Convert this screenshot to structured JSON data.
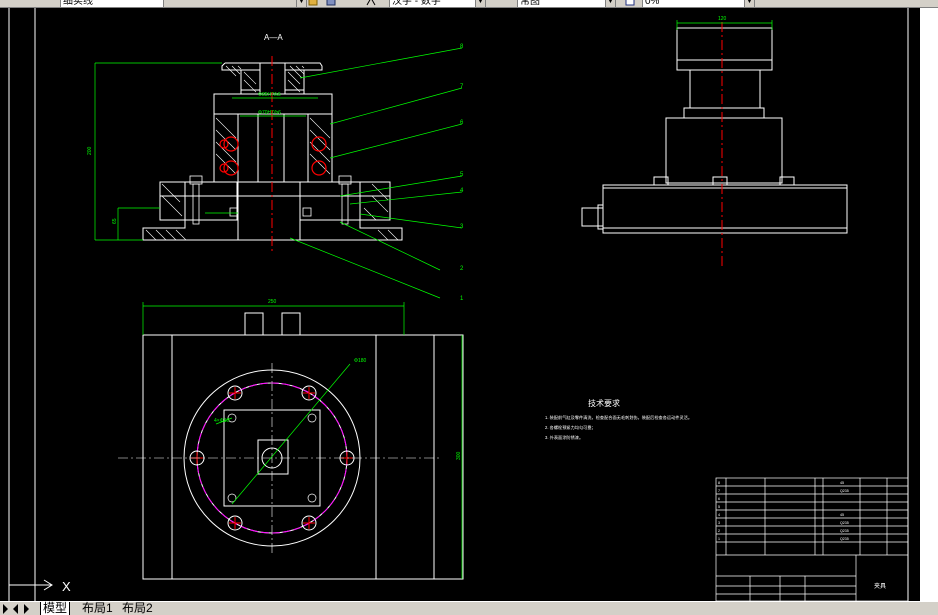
{
  "toolbar": {
    "layer_name": "细实线",
    "text_style": "汉字 - 数字",
    "dim_style": "常图",
    "layer_state": "0%"
  },
  "drawing": {
    "section_label": "A—A",
    "tech_title": "技术要求",
    "tech_notes": [
      "1. 装配前气缸及零件清洗，检查配合面无毛刺划伤。装配后检查各运动件灵活。",
      "2. 各螺栓预紧力均匀可靠；",
      "3. 外表面涂防锈漆。"
    ],
    "title_block_name": "夹具",
    "balloons": [
      "8",
      "7",
      "6",
      "5",
      "4",
      "3",
      "2",
      "1"
    ],
    "dims": {
      "height_total": "200",
      "height_lower": "65",
      "fit_top": "Φ85H7/k6",
      "fit_mid": "Φ70H7/h6",
      "base_width": "250",
      "plan_height": "300",
      "pcd": "Φ180",
      "hole": "4×Φ10",
      "right_top": "120"
    }
  },
  "tabs": {
    "model": "模型",
    "layout1": "布局1",
    "layout2": "布局2"
  },
  "ucs_label": "X"
}
